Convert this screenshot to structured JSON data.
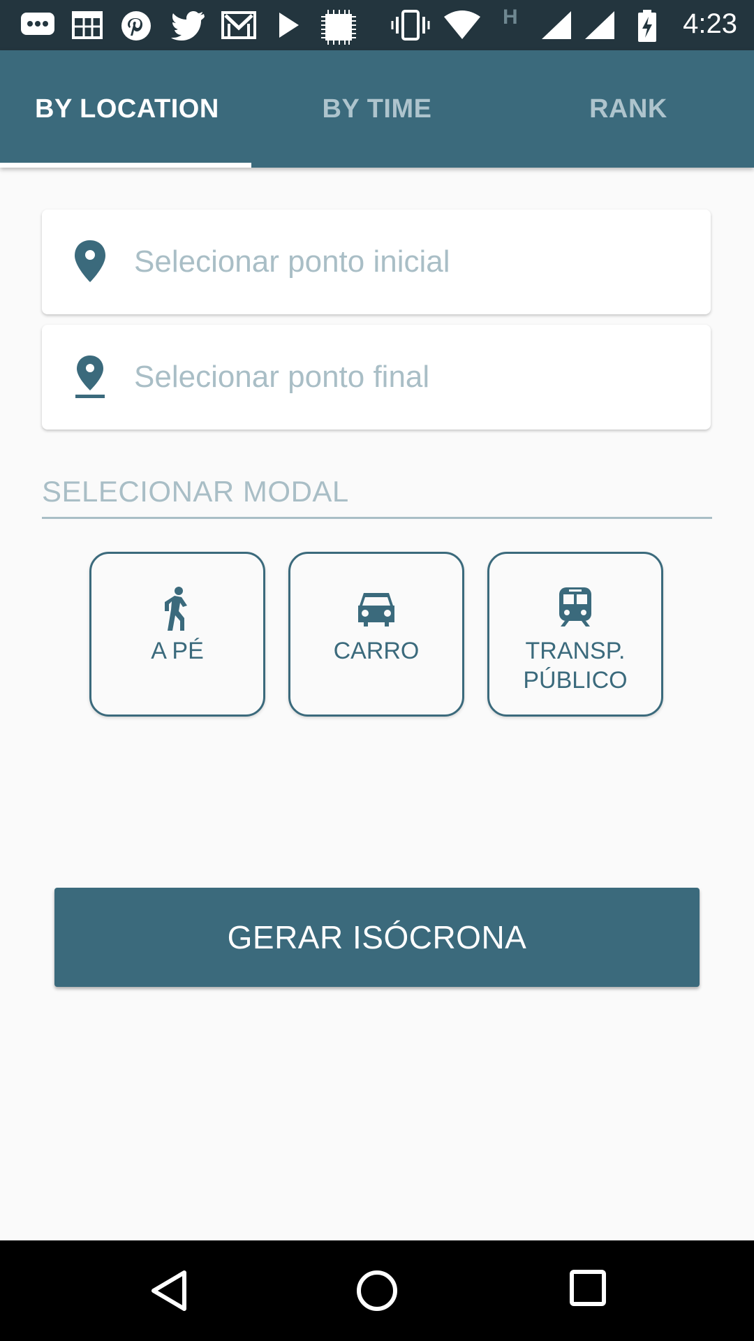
{
  "status_bar": {
    "time": "4:23",
    "network_label": "H",
    "icons": [
      "message-icon",
      "calendar-icon",
      "pinterest-icon",
      "twitter-icon",
      "gmail-icon",
      "play-store-icon",
      "chip-icon",
      "vibrate-icon",
      "wifi-icon",
      "signal-icon",
      "signal-icon-2",
      "battery-charging-icon"
    ]
  },
  "tabs": [
    {
      "label": "BY LOCATION",
      "active": true
    },
    {
      "label": "BY TIME",
      "active": false
    },
    {
      "label": "RANK",
      "active": false
    }
  ],
  "fields": {
    "start": {
      "placeholder": "Selecionar ponto inicial",
      "icon": "location-pin-icon"
    },
    "end": {
      "placeholder": "Selecionar ponto final",
      "icon": "place-pin-icon"
    }
  },
  "modal": {
    "label": "SELECIONAR MODAL",
    "options": [
      {
        "label": "A PÉ",
        "icon": "walk-icon"
      },
      {
        "label": "CARRO",
        "icon": "car-icon"
      },
      {
        "label_line1": "TRANSP.",
        "label_line2": "PÚBLICO",
        "icon": "train-icon"
      }
    ]
  },
  "action": {
    "label": "GERAR ISÓCRONA"
  },
  "colors": {
    "primary": "#3b6a7c",
    "status_bar": "#23353e",
    "hint": "#a9bec6",
    "background": "#fafafa"
  },
  "nav_bar": {
    "buttons": [
      "back-icon",
      "home-icon",
      "recents-icon"
    ]
  }
}
